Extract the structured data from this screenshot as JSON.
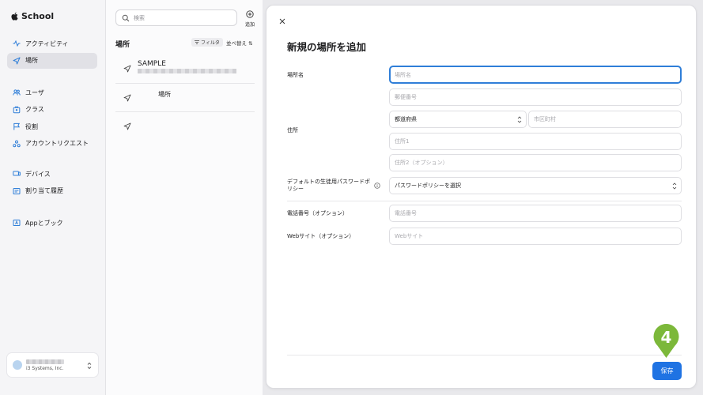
{
  "sidebar": {
    "brand": "School",
    "items_top": [
      {
        "label": "アクティビティ",
        "icon": "activity-icon"
      },
      {
        "label": "場所",
        "icon": "location-arrow-icon",
        "active": true
      }
    ],
    "items_mid": [
      {
        "label": "ユーザ",
        "icon": "users-icon"
      },
      {
        "label": "クラス",
        "icon": "class-icon"
      },
      {
        "label": "役割",
        "icon": "flag-icon"
      },
      {
        "label": "アカウントリクエスト",
        "icon": "account-request-icon"
      }
    ],
    "items_dev": [
      {
        "label": "デバイス",
        "icon": "device-icon"
      },
      {
        "label": "割り当て履歴",
        "icon": "history-icon"
      }
    ],
    "items_apps": [
      {
        "label": "Appとブック",
        "icon": "apps-icon"
      }
    ],
    "account": {
      "org": "i3 Systems, Inc."
    }
  },
  "list": {
    "search_placeholder": "検索",
    "add_label": "追加",
    "title": "場所",
    "filter_label": "フィルタ",
    "sort_label": "並べ替え",
    "rows": [
      {
        "title": "SAMPLE"
      },
      {
        "title": "場所"
      },
      {
        "title": ""
      }
    ]
  },
  "modal": {
    "title": "新規の場所を追加",
    "labels": {
      "place_name": "場所名",
      "address": "住所",
      "password_policy": "デフォルトの生徒用パスワードポリシー",
      "phone": "電話番号（オプション）",
      "website": "Webサイト（オプション）"
    },
    "placeholders": {
      "place_name": "場所名",
      "postal": "郵便番号",
      "prefecture": "都道府県",
      "city": "市区町村",
      "address1": "住所1",
      "address2": "住所2（オプション）",
      "password_policy": "パスワードポリシーを選択",
      "phone": "電話番号",
      "website": "Webサイト"
    },
    "save_label": "保存"
  },
  "callout": {
    "number": "4"
  },
  "colors": {
    "accent": "#1f73e3",
    "callout": "#7cb83a"
  }
}
